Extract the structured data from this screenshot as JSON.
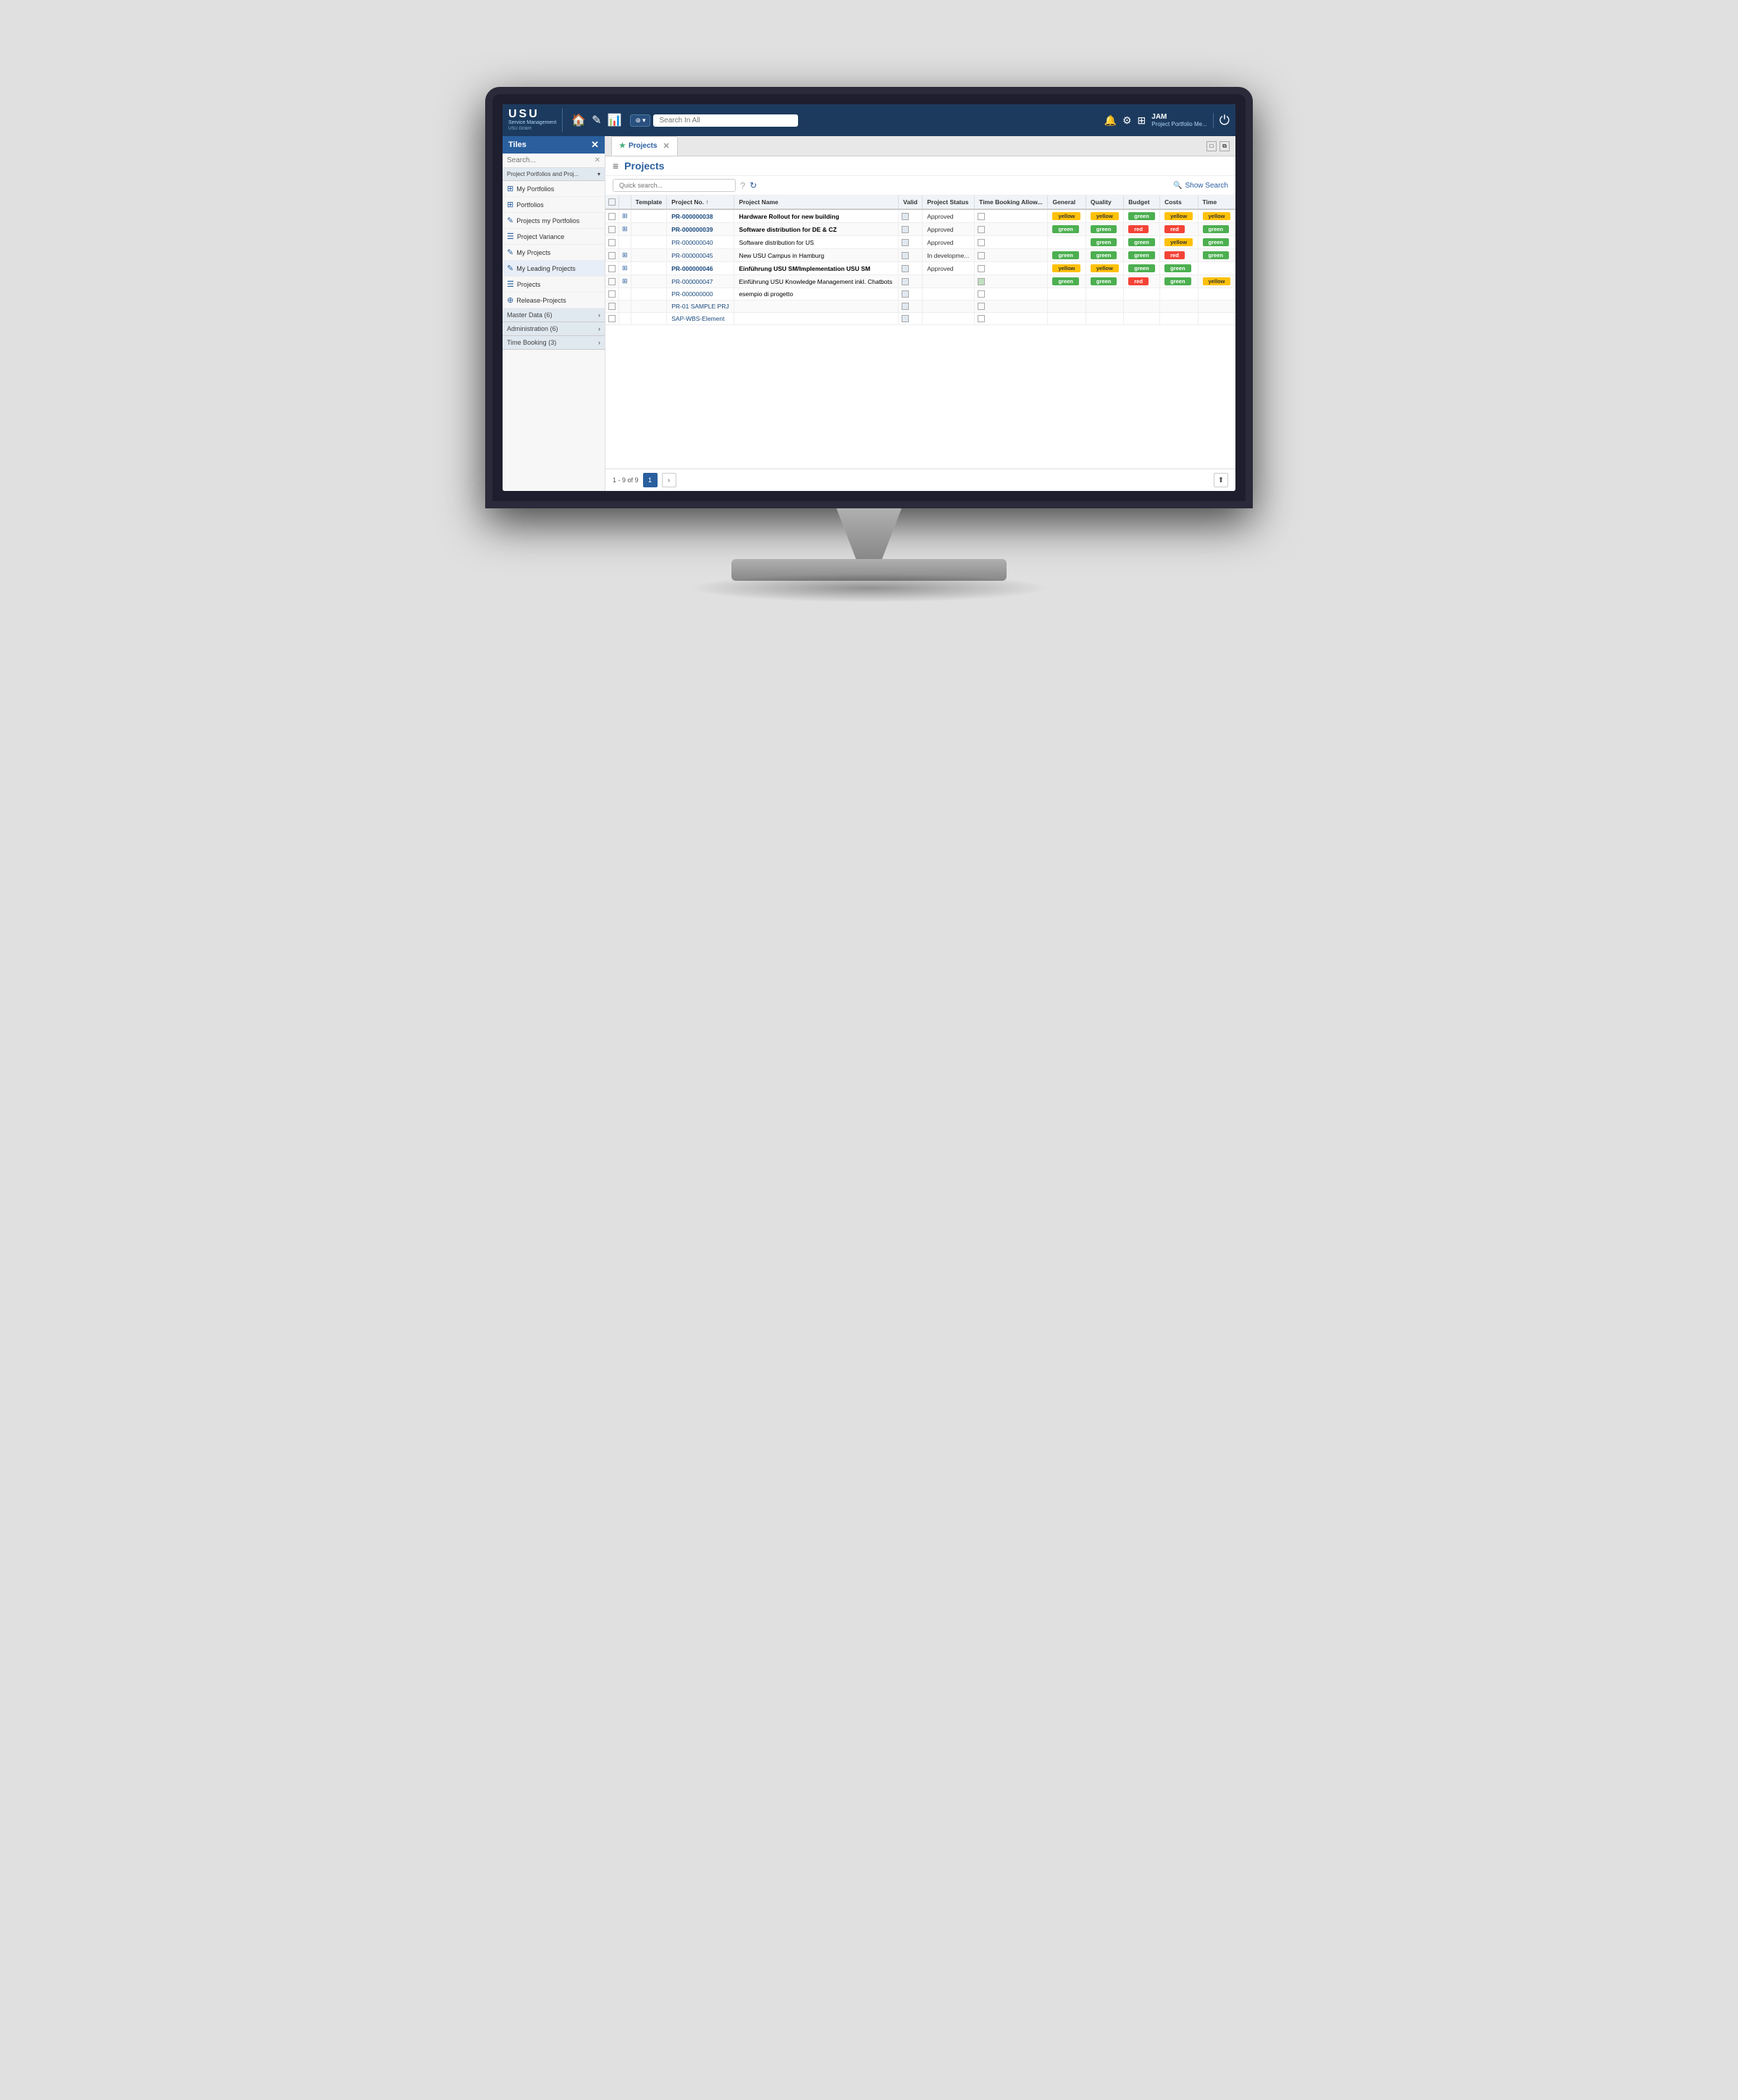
{
  "app": {
    "title": "USU Service Management",
    "subtitle": "Service Management",
    "company": "USU GmbH"
  },
  "topbar": {
    "logo": "USU",
    "logo_service": "Service",
    "logo_mgmt": "Management",
    "logo_gmbh": "USU GmbH",
    "search_placeholder": "Search In All",
    "user_name": "JAM",
    "user_role": "Project Portfolio Me..."
  },
  "sidebar": {
    "header_label": "Tiles",
    "search_placeholder": "Search...",
    "category_label": "Project Portfolios and Proj...",
    "items": [
      {
        "id": "my-portfolios",
        "label": "My Portfolios",
        "icon": "⊞"
      },
      {
        "id": "portfolios",
        "label": "Portfolios",
        "icon": "⊞"
      },
      {
        "id": "projects-my-portfolios",
        "label": "Projects my Portfolios",
        "icon": "✎"
      },
      {
        "id": "project-variance",
        "label": "Project Variance",
        "icon": "☰"
      },
      {
        "id": "my-projects",
        "label": "My Projects",
        "icon": "✎"
      },
      {
        "id": "my-leading-projects",
        "label": "My Leading Projects",
        "icon": "✎"
      },
      {
        "id": "projects",
        "label": "Projects",
        "icon": "☰"
      },
      {
        "id": "release-projects",
        "label": "Release-Projects",
        "icon": "⊕"
      }
    ],
    "collapse_items": [
      {
        "id": "master-data",
        "label": "Master Data (6)",
        "has_arrow": true
      },
      {
        "id": "administration",
        "label": "Administration (6)",
        "has_arrow": true
      },
      {
        "id": "time-booking",
        "label": "Time Booking (3)",
        "has_arrow": true
      }
    ]
  },
  "tabs": [
    {
      "id": "projects-tab",
      "label": "Projects",
      "active": true,
      "closeable": true
    }
  ],
  "projects": {
    "title": "Projects",
    "search_placeholder": "Quick search...",
    "show_search_label": "Show Search",
    "columns": [
      {
        "id": "cb1",
        "label": ""
      },
      {
        "id": "cb2",
        "label": ""
      },
      {
        "id": "template",
        "label": "Template"
      },
      {
        "id": "project_no",
        "label": "Project No. ↑"
      },
      {
        "id": "project_name",
        "label": "Project Name"
      },
      {
        "id": "valid",
        "label": "Valid"
      },
      {
        "id": "project_status",
        "label": "Project Status"
      },
      {
        "id": "time_booking",
        "label": "Time Booking Allow..."
      },
      {
        "id": "general",
        "label": "General"
      },
      {
        "id": "quality",
        "label": "Quality"
      },
      {
        "id": "budget",
        "label": "Budget"
      },
      {
        "id": "costs",
        "label": "Costs"
      },
      {
        "id": "time",
        "label": "Time"
      }
    ],
    "rows": [
      {
        "id": 1,
        "template_icon": true,
        "project_no": "PR-000000038",
        "project_name": "Hardware Rollout for new building",
        "project_name_bold": true,
        "valid": true,
        "project_status": "Approved",
        "time_booking": false,
        "general": "yellow",
        "quality": "yellow",
        "budget": "green",
        "costs": "yellow",
        "time": "yellow",
        "selected": false
      },
      {
        "id": 2,
        "template_icon": true,
        "project_no": "PR-000000039",
        "project_name": "Software distribution for DE & CZ",
        "project_name_bold": true,
        "valid": true,
        "project_status": "Approved",
        "time_booking": false,
        "general": "green",
        "quality": "green",
        "budget": "red",
        "costs": "red",
        "time": "green",
        "selected": false
      },
      {
        "id": 3,
        "template_icon": false,
        "project_no": "PR-000000040",
        "project_name": "Software distribution for US",
        "project_name_bold": false,
        "valid": true,
        "project_status": "Approved",
        "time_booking": false,
        "general": "",
        "quality": "green",
        "budget": "green",
        "costs": "yellow",
        "time": "green",
        "selected": false
      },
      {
        "id": 4,
        "template_icon": true,
        "project_no": "PR-000000045",
        "project_name": "New USU Campus in Hamburg",
        "project_name_bold": false,
        "valid": true,
        "project_status": "In developme...",
        "time_booking": false,
        "general": "green",
        "quality": "green",
        "budget": "green",
        "costs": "red",
        "time": "green",
        "selected": false
      },
      {
        "id": 5,
        "template_icon": true,
        "project_no": "PR-000000046",
        "project_name": "Einführung USU SM/Implementation USU SM",
        "project_name_bold": true,
        "valid": true,
        "project_status": "Approved",
        "time_booking": false,
        "general": "yellow",
        "quality": "yellow",
        "budget": "green",
        "costs": "green",
        "time": "",
        "selected": false
      },
      {
        "id": 6,
        "template_icon": true,
        "project_no": "PR-000000047",
        "project_name": "Einführung USU Knowledge Management inkl. Chatbots",
        "project_name_bold": false,
        "valid": true,
        "project_status": "",
        "time_booking": true,
        "general": "green",
        "quality": "green",
        "budget": "red",
        "costs": "green",
        "time": "yellow",
        "selected": false
      },
      {
        "id": 7,
        "template_icon": false,
        "project_no": "PR-000000000",
        "project_name": "esempio di progetto",
        "project_name_bold": false,
        "valid": true,
        "project_status": "",
        "time_booking": false,
        "general": "",
        "quality": "",
        "budget": "",
        "costs": "",
        "time": "",
        "selected": false
      },
      {
        "id": 8,
        "template_icon": false,
        "project_no": "PR-01 SAMPLE PRJ",
        "project_name": "",
        "project_name_bold": false,
        "valid": true,
        "project_status": "",
        "time_booking": false,
        "general": "",
        "quality": "",
        "budget": "",
        "costs": "",
        "time": "",
        "selected": false
      },
      {
        "id": 9,
        "template_icon": false,
        "project_no": "SAP-WBS-Element",
        "project_name": "",
        "project_name_bold": false,
        "valid": true,
        "project_status": "",
        "time_booking": false,
        "general": "",
        "quality": "",
        "budget": "",
        "costs": "",
        "time": "",
        "selected": false
      }
    ],
    "pagination": {
      "info": "1 - 9 of 9",
      "current_page": 1,
      "total_pages": 1
    }
  },
  "colors": {
    "green": "#4caf50",
    "yellow": "#ffc107",
    "red": "#f44336",
    "primary": "#1c3a5e",
    "accent": "#2a5f9e"
  }
}
